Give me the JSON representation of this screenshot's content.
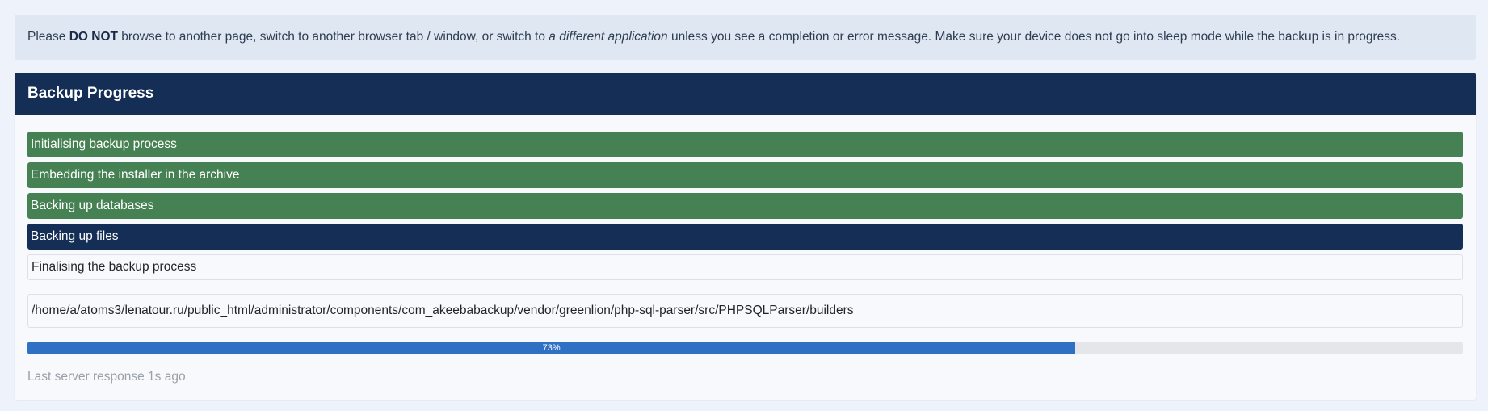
{
  "warning": {
    "text_1": "Please ",
    "bold_1": "DO NOT",
    "text_2": " browse to another page, switch to another browser tab / window, or switch to ",
    "italic_1": "a different application",
    "text_3": " unless you see a completion or error message. Make sure your device does not go into sleep mode while the backup is in progress."
  },
  "card": {
    "title": "Backup Progress",
    "steps": [
      {
        "label": "Initialising backup process",
        "status": "done"
      },
      {
        "label": "Embedding the installer in the archive",
        "status": "done"
      },
      {
        "label": "Backing up databases",
        "status": "done"
      },
      {
        "label": "Backing up files",
        "status": "active"
      },
      {
        "label": "Finalising the backup process",
        "status": "pending"
      }
    ],
    "current_path": "/home/a/atoms3/lenatour.ru/public_html/administrator/components/com_akeebabackup/vendor/greenlion/php-sql-parser/src/PHPSQLParser/builders",
    "progress": {
      "percent": 73,
      "label": "73%"
    },
    "last_response": "Last server response 1s ago"
  },
  "colors": {
    "header": "#142e55",
    "done": "#468153",
    "active": "#142e55",
    "progress": "#2f6fc4"
  }
}
